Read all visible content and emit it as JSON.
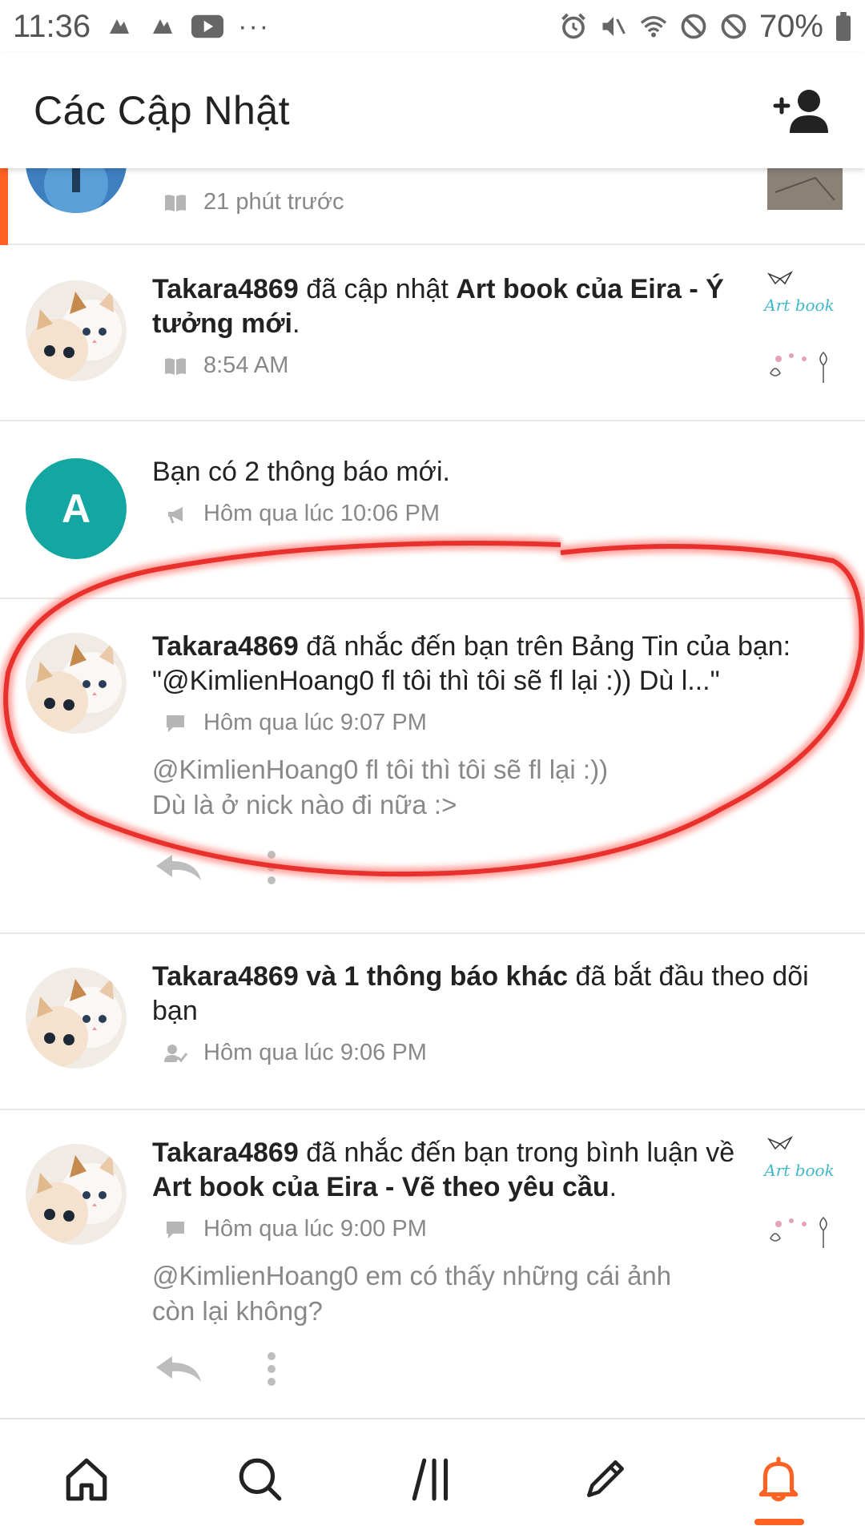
{
  "status_bar": {
    "time": "11:36",
    "more": "···",
    "battery": "70%"
  },
  "header": {
    "title": "Các Cập Nhật",
    "add_friend_icon": "add-person-icon"
  },
  "colors": {
    "accent": "#ff6122",
    "teal": "#14a7a2",
    "muted": "#888888",
    "scribble_red": "#e8312c"
  },
  "feed": [
    {
      "time": "21 phút trước",
      "meta_icon": "book-icon"
    },
    {
      "user": "Takara4869",
      "text1": "đã cập nhật",
      "story": "Art book của Eira - Ý tưởng mới",
      "end": ".",
      "time": "8:54 AM",
      "meta_icon": "book-icon",
      "thumb_title": "Art book"
    },
    {
      "avatar_letter": "A",
      "text": "Bạn có 2 thông báo mới.",
      "time": "Hôm qua lúc 10:06 PM",
      "meta_icon": "megaphone-icon"
    },
    {
      "user": "Takara4869",
      "text1": "đã nhắc đến bạn trên Bảng Tin của bạn:",
      "quote": "\"@KimlienHoang0 fl tôi thì tôi sẽ fl lại :)) Dù l...\"",
      "time": "Hôm qua lúc 9:07 PM",
      "meta_icon": "comment-icon",
      "snippet_line1": "@KimlienHoang0  fl tôi thì tôi sẽ fl lại :))",
      "snippet_line2": "Dù là ở nick nào đi nữa :>"
    },
    {
      "user_bold": "Takara4869 và 1 thông báo khác",
      "text1": "đã bắt đầu theo dõi bạn",
      "time": "Hôm qua lúc 9:06 PM",
      "meta_icon": "follow-icon"
    },
    {
      "user": "Takara4869",
      "text1": "đã nhắc đến bạn trong bình luận về",
      "story": "Art book của Eira - Vẽ theo yêu cầu",
      "end": ".",
      "time": "Hôm qua lúc 9:00 PM",
      "meta_icon": "comment-icon",
      "snippet_line1": "@KimlienHoang0  em có thấy những cái ảnh",
      "snippet_line2": "còn lại không?",
      "thumb_title": "Art book"
    }
  ],
  "bottom_nav": [
    {
      "name": "home",
      "icon": "home-icon"
    },
    {
      "name": "search",
      "icon": "search-icon"
    },
    {
      "name": "library",
      "icon": "library-icon"
    },
    {
      "name": "write",
      "icon": "pencil-icon"
    },
    {
      "name": "notifications",
      "icon": "bell-icon",
      "active": true
    }
  ]
}
